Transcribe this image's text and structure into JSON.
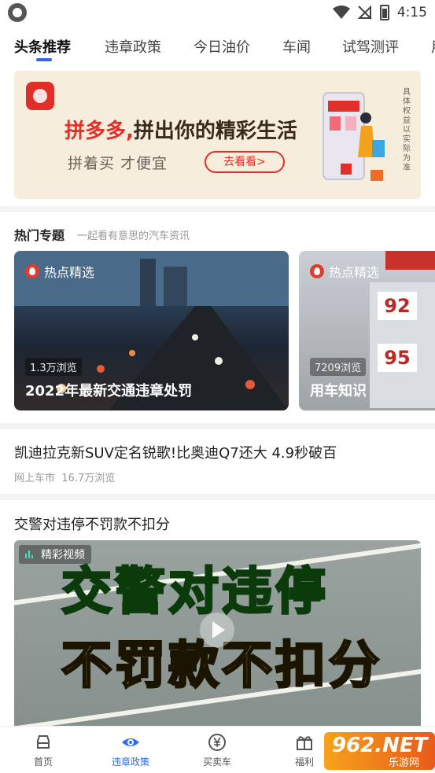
{
  "status_bar": {
    "time": "4:15"
  },
  "tabs": [
    {
      "label": "头条推荐"
    },
    {
      "label": "违章政策"
    },
    {
      "label": "今日油价"
    },
    {
      "label": "车闻"
    },
    {
      "label": "试驾测评"
    },
    {
      "label": "用"
    }
  ],
  "banner": {
    "headline_brand": "拼多多,",
    "headline_rest": "拼出你的精彩生活",
    "subline": "拼着买 才便宜",
    "cta": "去看看>",
    "sidenote": "具体权益以实际为准"
  },
  "hot_section": {
    "title": "热门专题",
    "subtitle": "一起看有意思的汽车资讯",
    "cards": [
      {
        "tag": "热点精选",
        "views": "1.3万浏览",
        "title": "2022年最新交通违章处罚"
      },
      {
        "tag": "热点精选",
        "views": "7209浏览",
        "title": "用车知识",
        "prices": [
          "92",
          "95"
        ]
      }
    ]
  },
  "news": [
    {
      "title": "凯迪拉克新SUV定名锐歌!比奥迪Q7还大 4.9秒破百",
      "source": "网上车市",
      "views": "16.7万浏览"
    },
    {
      "title": "交警对违停不罚款不扣分"
    }
  ],
  "video": {
    "tag": "精彩视频",
    "line1": "交警对违停",
    "line2": "不罚款不扣分"
  },
  "bottom_nav": [
    {
      "label": "首页"
    },
    {
      "label": "违章政策"
    },
    {
      "label": "买卖车"
    },
    {
      "label": "福利"
    }
  ],
  "watermark": {
    "big": "962.NET",
    "small": "乐游网"
  },
  "colors": {
    "accent": "#2c6bf0",
    "pdd_red": "#e0302a"
  }
}
